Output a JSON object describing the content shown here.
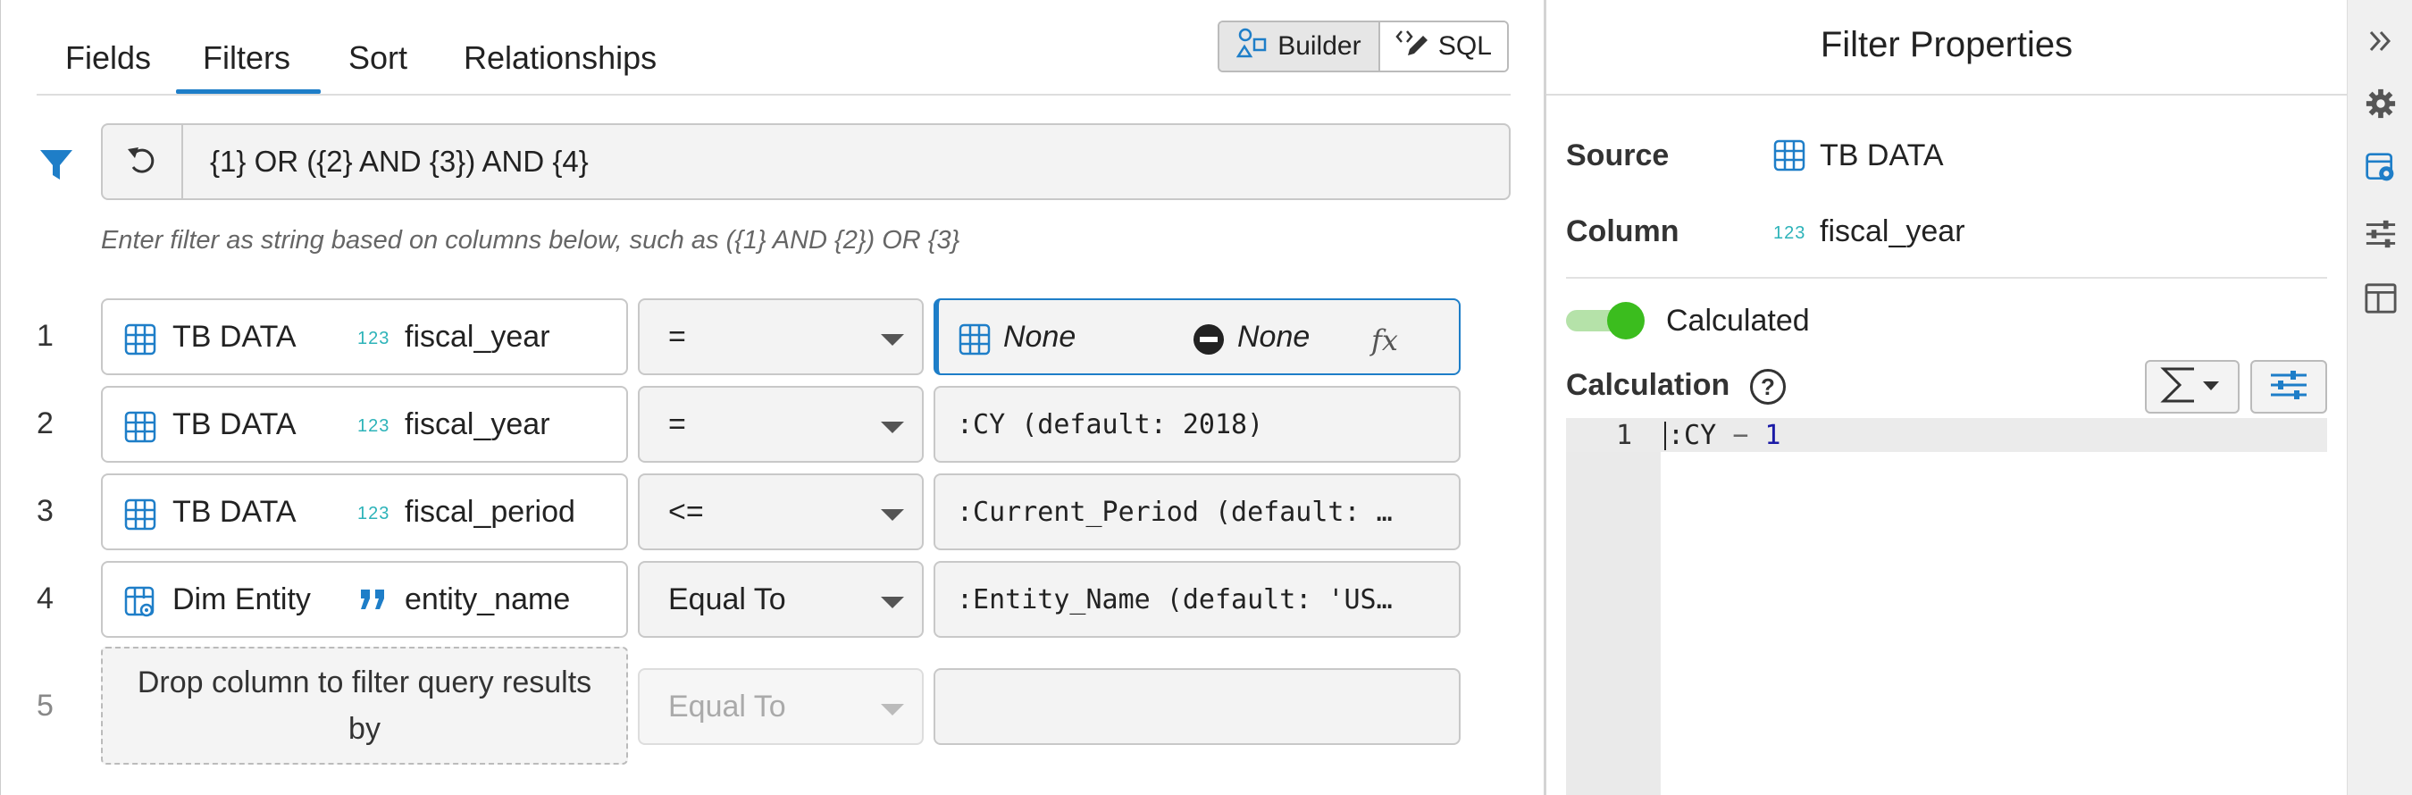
{
  "tabs": [
    {
      "label": "Fields"
    },
    {
      "label": "Filters",
      "active": true
    },
    {
      "label": "Sort"
    },
    {
      "label": "Relationships"
    }
  ],
  "mode_toggle": {
    "builder_label": "Builder",
    "sql_label": "SQL",
    "active": "Builder"
  },
  "filter_expression": {
    "value": "{1} OR ({2} AND {3}) AND {4}",
    "hint": "Enter filter as string based on columns below, such as ({1} AND {2}) OR {3}"
  },
  "filters": [
    {
      "num": "1",
      "table": "TB DATA",
      "type_label": "123",
      "column": "fiscal_year",
      "operator": "=",
      "value_left": "None",
      "value_right": "None",
      "fx": "fx"
    },
    {
      "num": "2",
      "table": "TB DATA",
      "type_label": "123",
      "column": "fiscal_year",
      "operator": "=",
      "value": ":CY (default: 2018)"
    },
    {
      "num": "3",
      "table": "TB DATA",
      "type_label": "123",
      "column": "fiscal_period",
      "operator": "<=",
      "value": ":Current_Period (default: …"
    },
    {
      "num": "4",
      "table": "Dim Entity",
      "type_label": "quote",
      "column": "entity_name",
      "operator": "Equal To",
      "value": ":Entity_Name (default: 'US…"
    }
  ],
  "drop_row": {
    "num": "5",
    "placeholder": "Drop column to filter query results by",
    "operator": "Equal To",
    "value": ""
  },
  "properties_panel": {
    "title": "Filter Properties",
    "source_label": "Source",
    "source_value": "TB DATA",
    "column_label": "Column",
    "column_type": "123",
    "column_value": "fiscal_year",
    "calculated_label": "Calculated",
    "calculated_on": true,
    "calculation_label": "Calculation",
    "help_glyph": "?",
    "editor": {
      "line": "1",
      "code_prefix": ":CY ",
      "code_op": "−",
      "code_num": " 1"
    }
  },
  "side_rail": {
    "icons": [
      "collapse-panel-icon",
      "settings-gear-icon",
      "filter-properties-icon",
      "sliders-icon",
      "layout-icon"
    ]
  },
  "colors": {
    "accent": "#1e7ec8",
    "toggle_on": "#3bbd1e",
    "teal_type": "#2db3b9"
  }
}
